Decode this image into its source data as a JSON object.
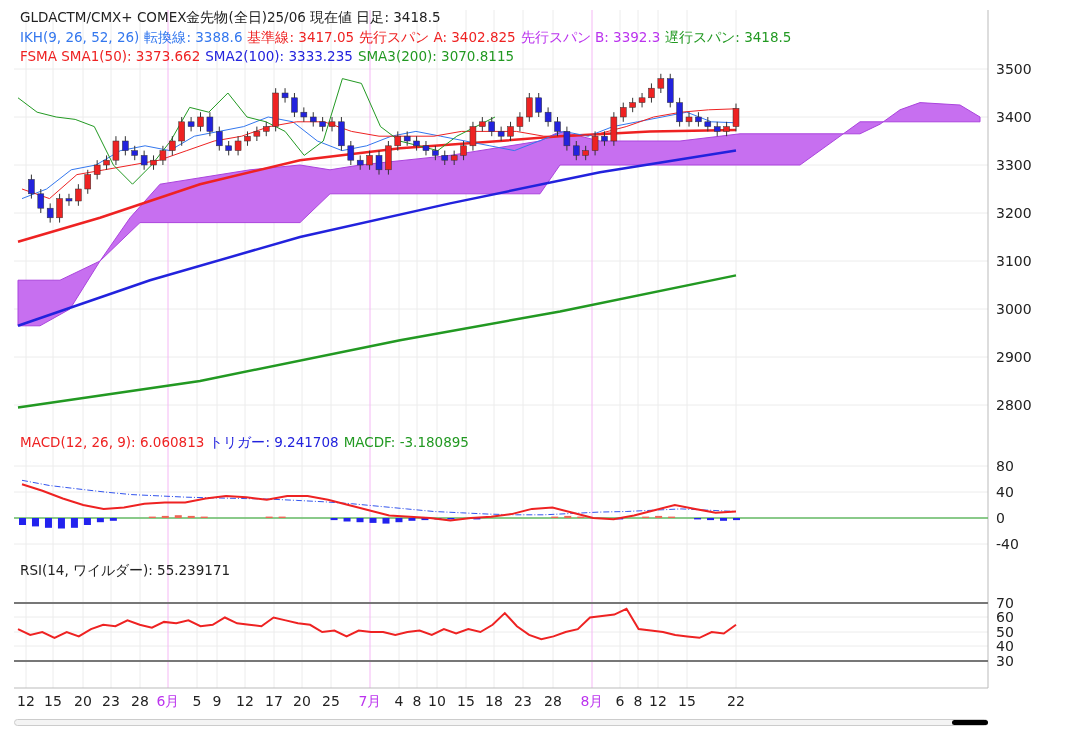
{
  "price_panel": {
    "legend": [
      [
        {
          "text": "GLDACTM/CMX+ COMEX金先物(全日)25/06  現在値 日足: 3418.5",
          "color": "#222222"
        }
      ],
      [
        {
          "text": "IKH(9, 26, 52, 26)",
          "color": "#3377ee"
        },
        {
          "text": "転換線: 3388.6",
          "color": "#3377ee"
        },
        {
          "text": "基準線: 3417.05",
          "color": "#ee2222"
        },
        {
          "text": "先行スパン A: 3402.825",
          "color": "#ee2222"
        },
        {
          "text": "先行スパン B: 3392.3",
          "color": "#bb33ee"
        },
        {
          "text": "遅行スパン: 3418.5",
          "color": "#229922"
        }
      ],
      [
        {
          "text": "FSMA SMA1(50): 3373.662",
          "color": "#ee2222"
        },
        {
          "text": "SMA2(100): 3333.235",
          "color": "#2222dd"
        },
        {
          "text": "SMA3(200): 3070.8115",
          "color": "#229922"
        }
      ]
    ],
    "y_ticks": [
      "3500",
      "3400",
      "3300",
      "3200",
      "3100",
      "3000",
      "2900",
      "2800"
    ]
  },
  "macd_panel": {
    "legend": [
      [
        {
          "text": "MACD(12, 26, 9): 6.060813",
          "color": "#ee2222"
        },
        {
          "text": "トリガー: 9.241708",
          "color": "#2222dd"
        },
        {
          "text": "MACDF: -3.180895",
          "color": "#229922"
        }
      ]
    ],
    "y_ticks": [
      "80",
      "40",
      "0",
      "-40"
    ]
  },
  "rsi_panel": {
    "legend": [
      [
        {
          "text": "RSI(14, ワイルダー): 55.239171",
          "color": "#222222"
        }
      ]
    ],
    "y_ticks": [
      "70",
      "60",
      "50",
      "40",
      "30"
    ]
  },
  "x_axis": [
    {
      "text": "12",
      "kind": "day"
    },
    {
      "text": "15",
      "kind": "day"
    },
    {
      "text": "20",
      "kind": "day"
    },
    {
      "text": "23",
      "kind": "day"
    },
    {
      "text": "28",
      "kind": "day"
    },
    {
      "text": "6月",
      "kind": "month"
    },
    {
      "text": "5",
      "kind": "day"
    },
    {
      "text": "9",
      "kind": "day"
    },
    {
      "text": "12",
      "kind": "day"
    },
    {
      "text": "17",
      "kind": "day"
    },
    {
      "text": "20",
      "kind": "day"
    },
    {
      "text": "25",
      "kind": "day"
    },
    {
      "text": "7月",
      "kind": "month"
    },
    {
      "text": "4",
      "kind": "day"
    },
    {
      "text": "8",
      "kind": "day"
    },
    {
      "text": "10",
      "kind": "day"
    },
    {
      "text": "15",
      "kind": "day"
    },
    {
      "text": "18",
      "kind": "day"
    },
    {
      "text": "23",
      "kind": "day"
    },
    {
      "text": "28",
      "kind": "day"
    },
    {
      "text": "8月",
      "kind": "month"
    },
    {
      "text": "6",
      "kind": "day"
    },
    {
      "text": "8",
      "kind": "day"
    },
    {
      "text": "12",
      "kind": "day"
    },
    {
      "text": "15",
      "kind": "day"
    },
    {
      "text": "22",
      "kind": "day"
    }
  ]
}
